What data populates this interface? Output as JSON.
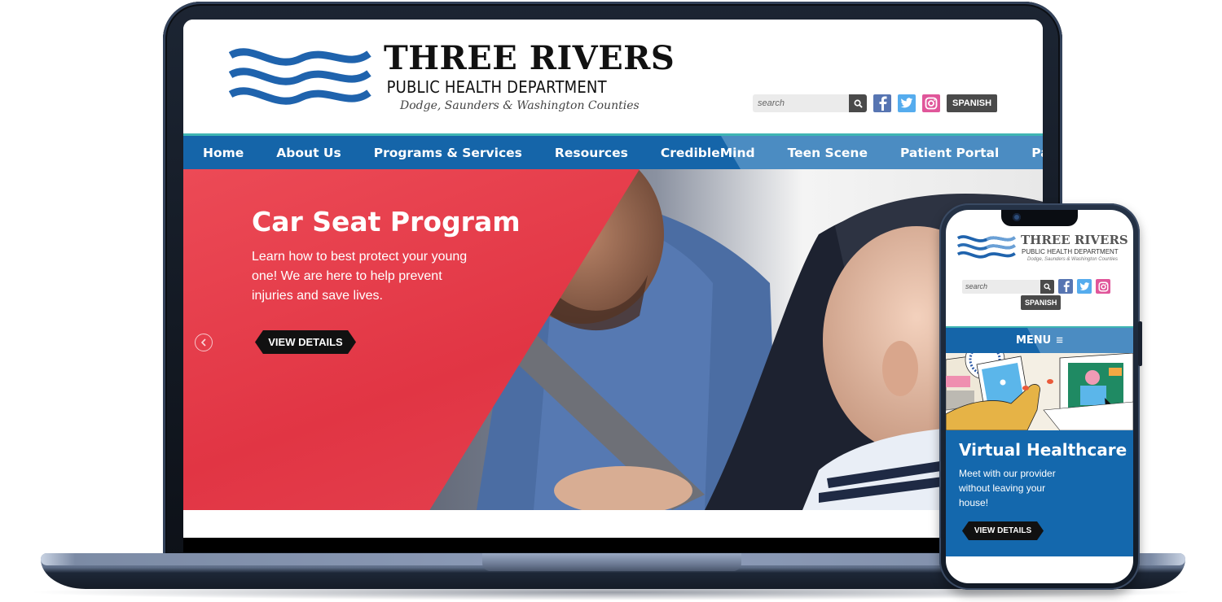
{
  "site": {
    "logo": {
      "title": "THREE RIVERS",
      "subtitle": "PUBLIC HEALTH DEPARTMENT",
      "counties": "Dodge, Saunders & Washington Counties"
    },
    "search": {
      "placeholder": "search",
      "icon": "search-icon"
    },
    "social": [
      {
        "name": "facebook",
        "icon": "facebook-icon",
        "color": "#5775b2"
      },
      {
        "name": "twitter",
        "icon": "twitter-icon",
        "color": "#55acee"
      },
      {
        "name": "instagram",
        "icon": "instagram-icon",
        "color": "#e0569a"
      }
    ],
    "language_button": "SPANISH",
    "nav": [
      {
        "label": "Home"
      },
      {
        "label": "About Us"
      },
      {
        "label": "Programs & Services"
      },
      {
        "label": "Resources"
      },
      {
        "label": "CredibleMind"
      },
      {
        "label": "Teen Scene"
      },
      {
        "label": "Patient Portal"
      },
      {
        "label": "Patient Survey"
      }
    ],
    "colors": {
      "nav_blue": "#1565a9",
      "nav_light_blue": "#4b8cc2",
      "nav_teal_border": "#3fb5b3",
      "hero_red": "#e13544",
      "button_dark": "#111111"
    }
  },
  "desktop_hero": {
    "title": "Car Seat Program",
    "body": "Learn how to best protect your young one! We are here to help prevent injuries and save lives.",
    "button": "VIEW DETAILS",
    "prev_icon": "chevron-left-icon"
  },
  "mobile": {
    "menu_label": "MENU",
    "menu_icon": "hamburger-icon",
    "card": {
      "title": "Virtual Healthcare",
      "body": "Meet with our provider without leaving your house!",
      "button": "VIEW DETAILS"
    }
  }
}
